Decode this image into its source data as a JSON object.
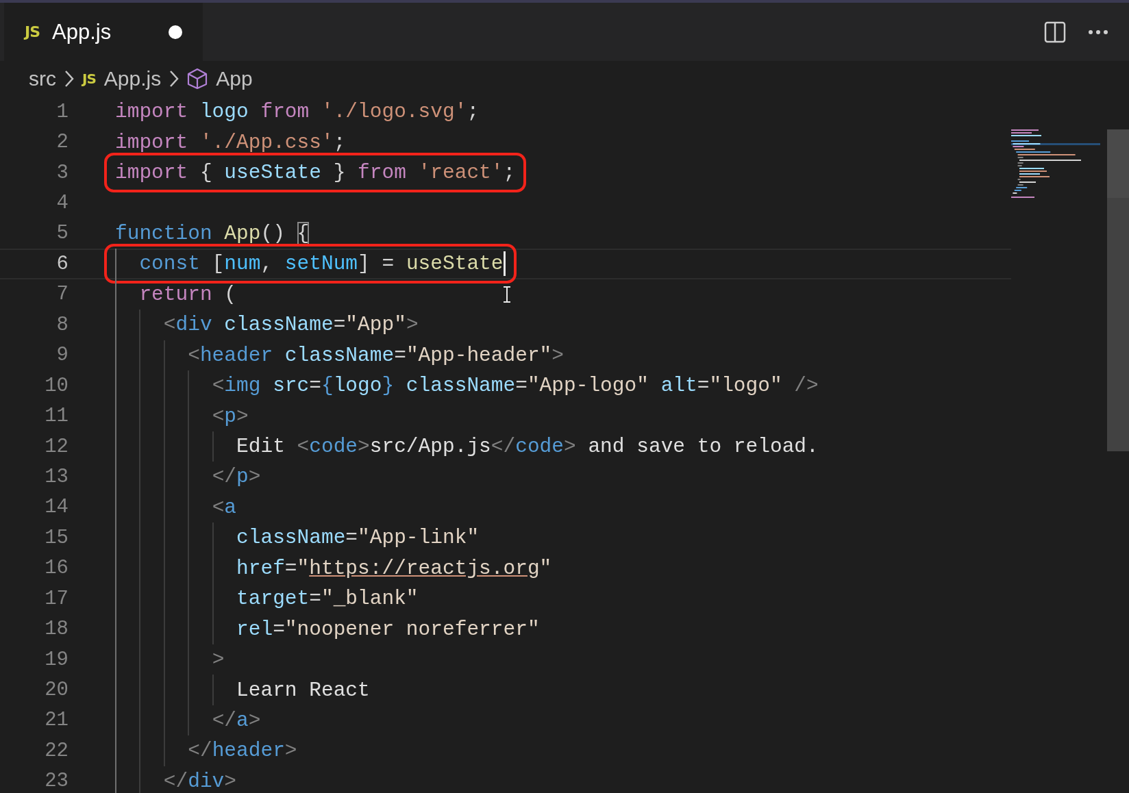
{
  "tabs": [
    {
      "badge": "JS",
      "label": "App.js",
      "modified": true,
      "selected": true
    }
  ],
  "breadcrumbs": [
    {
      "kind": "folder",
      "label": "src"
    },
    {
      "kind": "file",
      "badge": "JS",
      "label": "App.js"
    },
    {
      "kind": "symbol",
      "label": "App"
    }
  ],
  "lines": [
    {
      "number": "1",
      "current": false,
      "highlighted": false,
      "caret": false,
      "tokens": [
        {
          "kind": "kw",
          "text": "import "
        },
        {
          "kind": "var",
          "text": "logo "
        },
        {
          "kind": "kw",
          "text": "from "
        },
        {
          "kind": "str",
          "text": "'./logo.svg'"
        },
        {
          "kind": "punct",
          "text": ";"
        }
      ]
    },
    {
      "number": "2",
      "current": false,
      "highlighted": false,
      "caret": false,
      "tokens": [
        {
          "kind": "kw",
          "text": "import "
        },
        {
          "kind": "str",
          "text": "'./App.css'"
        },
        {
          "kind": "punct",
          "text": ";"
        }
      ]
    },
    {
      "number": "3",
      "current": false,
      "highlighted": true,
      "caret": false,
      "tokens": [
        {
          "kind": "kw",
          "text": "import"
        },
        {
          "kind": "punct",
          "text": " { "
        },
        {
          "kind": "var",
          "text": "useState"
        },
        {
          "kind": "punct",
          "text": " } "
        },
        {
          "kind": "kw",
          "text": "from "
        },
        {
          "kind": "str",
          "text": "'react'"
        },
        {
          "kind": "punct",
          "text": ";"
        }
      ]
    },
    {
      "number": "4",
      "current": false,
      "highlighted": false,
      "caret": false
    },
    {
      "number": "5",
      "current": false,
      "highlighted": false,
      "caret": false,
      "tokens": [
        {
          "kind": "storage",
          "text": "function "
        },
        {
          "kind": "fn",
          "text": "App"
        },
        {
          "kind": "punct",
          "text": "() "
        },
        {
          "kind": "match",
          "text": "{"
        }
      ]
    },
    {
      "number": "6",
      "current": true,
      "highlighted": true,
      "caret": true,
      "tokens": [
        {
          "kind": "storage",
          "text": "  const"
        },
        {
          "kind": "punct",
          "text": " ["
        },
        {
          "kind": "const",
          "text": "num"
        },
        {
          "kind": "punct",
          "text": ", "
        },
        {
          "kind": "const",
          "text": "setNum"
        },
        {
          "kind": "punct",
          "text": "] = "
        },
        {
          "kind": "fn",
          "text": "useState"
        }
      ]
    },
    {
      "number": "7",
      "current": false,
      "highlighted": false,
      "caret": false,
      "tokens": [
        {
          "kind": "kw",
          "text": "  return"
        },
        {
          "kind": "punct",
          "text": " ("
        }
      ]
    },
    {
      "number": "8",
      "current": false,
      "highlighted": false,
      "caret": false,
      "tokens": [
        {
          "kind": "tagp",
          "text": "    <"
        },
        {
          "kind": "tag",
          "text": "div"
        },
        {
          "kind": "attr",
          "text": " className"
        },
        {
          "kind": "punct",
          "text": "="
        },
        {
          "kind": "jstr",
          "text": "\"App\""
        },
        {
          "kind": "tagp",
          "text": ">"
        }
      ]
    },
    {
      "number": "9",
      "current": false,
      "highlighted": false,
      "caret": false,
      "tokens": [
        {
          "kind": "tagp",
          "text": "      <"
        },
        {
          "kind": "tag",
          "text": "header"
        },
        {
          "kind": "attr",
          "text": " className"
        },
        {
          "kind": "punct",
          "text": "="
        },
        {
          "kind": "jstr",
          "text": "\"App-header\""
        },
        {
          "kind": "tagp",
          "text": ">"
        }
      ]
    },
    {
      "number": "10",
      "current": false,
      "highlighted": false,
      "caret": false,
      "tokens": [
        {
          "kind": "tagp",
          "text": "        <"
        },
        {
          "kind": "tag",
          "text": "img"
        },
        {
          "kind": "attr",
          "text": " src"
        },
        {
          "kind": "punct",
          "text": "="
        },
        {
          "kind": "brace",
          "text": "{"
        },
        {
          "kind": "var",
          "text": "logo"
        },
        {
          "kind": "brace",
          "text": "}"
        },
        {
          "kind": "attr",
          "text": " className"
        },
        {
          "kind": "punct",
          "text": "="
        },
        {
          "kind": "jstr",
          "text": "\"App-logo\""
        },
        {
          "kind": "attr",
          "text": " alt"
        },
        {
          "kind": "punct",
          "text": "="
        },
        {
          "kind": "jstr",
          "text": "\"logo\""
        },
        {
          "kind": "tagp",
          "text": " />"
        }
      ]
    },
    {
      "number": "11",
      "current": false,
      "highlighted": false,
      "caret": false,
      "tokens": [
        {
          "kind": "tagp",
          "text": "        <"
        },
        {
          "kind": "tag",
          "text": "p"
        },
        {
          "kind": "tagp",
          "text": ">"
        }
      ]
    },
    {
      "number": "12",
      "current": false,
      "highlighted": false,
      "caret": false,
      "tokens": [
        {
          "kind": "text",
          "text": "          Edit "
        },
        {
          "kind": "tagp",
          "text": "<"
        },
        {
          "kind": "tag",
          "text": "code"
        },
        {
          "kind": "tagp",
          "text": ">"
        },
        {
          "kind": "text",
          "text": "src/App.js"
        },
        {
          "kind": "tagp",
          "text": "</"
        },
        {
          "kind": "tag",
          "text": "code"
        },
        {
          "kind": "tagp",
          "text": ">"
        },
        {
          "kind": "text",
          "text": " and save to reload."
        }
      ]
    },
    {
      "number": "13",
      "current": false,
      "highlighted": false,
      "caret": false,
      "tokens": [
        {
          "kind": "tagp",
          "text": "        </"
        },
        {
          "kind": "tag",
          "text": "p"
        },
        {
          "kind": "tagp",
          "text": ">"
        }
      ]
    },
    {
      "number": "14",
      "current": false,
      "highlighted": false,
      "caret": false,
      "tokens": [
        {
          "kind": "tagp",
          "text": "        <"
        },
        {
          "kind": "tag",
          "text": "a"
        }
      ]
    },
    {
      "number": "15",
      "current": false,
      "highlighted": false,
      "caret": false,
      "tokens": [
        {
          "kind": "attr",
          "text": "          className"
        },
        {
          "kind": "punct",
          "text": "="
        },
        {
          "kind": "jstr",
          "text": "\"App-link\""
        }
      ]
    },
    {
      "number": "16",
      "current": false,
      "highlighted": false,
      "caret": false,
      "tokens": [
        {
          "kind": "attr",
          "text": "          href"
        },
        {
          "kind": "punct",
          "text": "="
        },
        {
          "kind": "jstr",
          "text": "\""
        },
        {
          "kind": "link",
          "text": "https://reactjs.org"
        },
        {
          "kind": "jstr",
          "text": "\""
        }
      ]
    },
    {
      "number": "17",
      "current": false,
      "highlighted": false,
      "caret": false,
      "tokens": [
        {
          "kind": "attr",
          "text": "          target"
        },
        {
          "kind": "punct",
          "text": "="
        },
        {
          "kind": "jstr",
          "text": "\"_blank\""
        }
      ]
    },
    {
      "number": "18",
      "current": false,
      "highlighted": false,
      "caret": false,
      "tokens": [
        {
          "kind": "attr",
          "text": "          rel"
        },
        {
          "kind": "punct",
          "text": "="
        },
        {
          "kind": "jstr",
          "text": "\"noopener noreferrer\""
        }
      ]
    },
    {
      "number": "19",
      "current": false,
      "highlighted": false,
      "caret": false,
      "tokens": [
        {
          "kind": "tagp",
          "text": "        >"
        }
      ]
    },
    {
      "number": "20",
      "current": false,
      "highlighted": false,
      "caret": false,
      "tokens": [
        {
          "kind": "text",
          "text": "          Learn React"
        }
      ]
    },
    {
      "number": "21",
      "current": false,
      "highlighted": false,
      "caret": false,
      "tokens": [
        {
          "kind": "tagp",
          "text": "        </"
        },
        {
          "kind": "tag",
          "text": "a"
        },
        {
          "kind": "tagp",
          "text": ">"
        }
      ]
    },
    {
      "number": "22",
      "current": false,
      "highlighted": false,
      "caret": false,
      "tokens": [
        {
          "kind": "tagp",
          "text": "      </"
        },
        {
          "kind": "tag",
          "text": "header"
        },
        {
          "kind": "tagp",
          "text": ">"
        }
      ]
    },
    {
      "number": "23",
      "current": false,
      "highlighted": false,
      "caret": false,
      "tokens": [
        {
          "kind": "tagp",
          "text": "    </"
        },
        {
          "kind": "tag",
          "text": "div"
        },
        {
          "kind": "tagp",
          "text": ">"
        }
      ]
    }
  ]
}
